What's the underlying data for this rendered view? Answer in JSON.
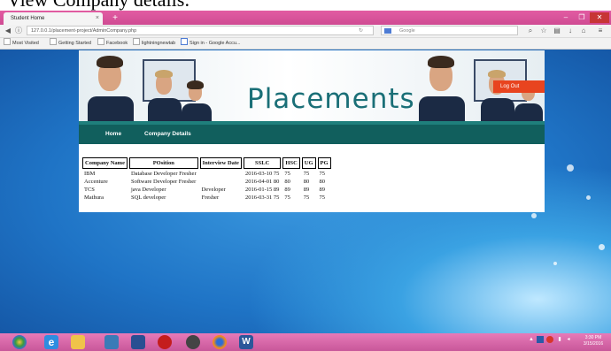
{
  "caption": "View Company details:",
  "browser": {
    "tab_title": "Student Home",
    "tab_close": "×",
    "new_tab": "+",
    "window_controls": [
      "–",
      "❐",
      "✕"
    ],
    "url": "127.0.0.1/placement-project/AdminCompany.php",
    "search_placeholder": "Google",
    "bookmarks": [
      "Most Visited",
      "Getting Started",
      "Facebook",
      "lightningnewtab",
      "Sign in - Google Accu..."
    ]
  },
  "site": {
    "brand": "Placements",
    "logout_label": "Log Out",
    "menu": [
      "Home",
      "Company Details"
    ],
    "table": {
      "headers": [
        "Company Name",
        "POsition",
        "Interview Date",
        "SSLC",
        "HSC",
        "UG",
        "PG"
      ],
      "rows": [
        [
          "IBM",
          "Database Developer",
          "Fresher",
          "2016-03-10",
          "75",
          "75",
          "75",
          "75"
        ],
        [
          "Accenture",
          "Software Developer",
          "Fresher",
          "2016-04-01",
          "80",
          "80",
          "80",
          "80"
        ],
        [
          "TCS",
          "java Developer",
          "Developer",
          "2016-01-15",
          "89",
          "89",
          "89",
          "89"
        ],
        [
          "Mathura",
          "SQL developer",
          "Fresher",
          "2016-03-31",
          "75",
          "75",
          "75",
          "75"
        ]
      ]
    }
  },
  "taskbar": {
    "clock_time": "3:30 PM",
    "clock_date": "3/15/2016"
  },
  "colors": {
    "titlebar": "#d9529c",
    "menubar": "#115f5d",
    "brand_text": "#1a6f77",
    "logout": "#e8441f",
    "desktop": "#1f74c6"
  }
}
